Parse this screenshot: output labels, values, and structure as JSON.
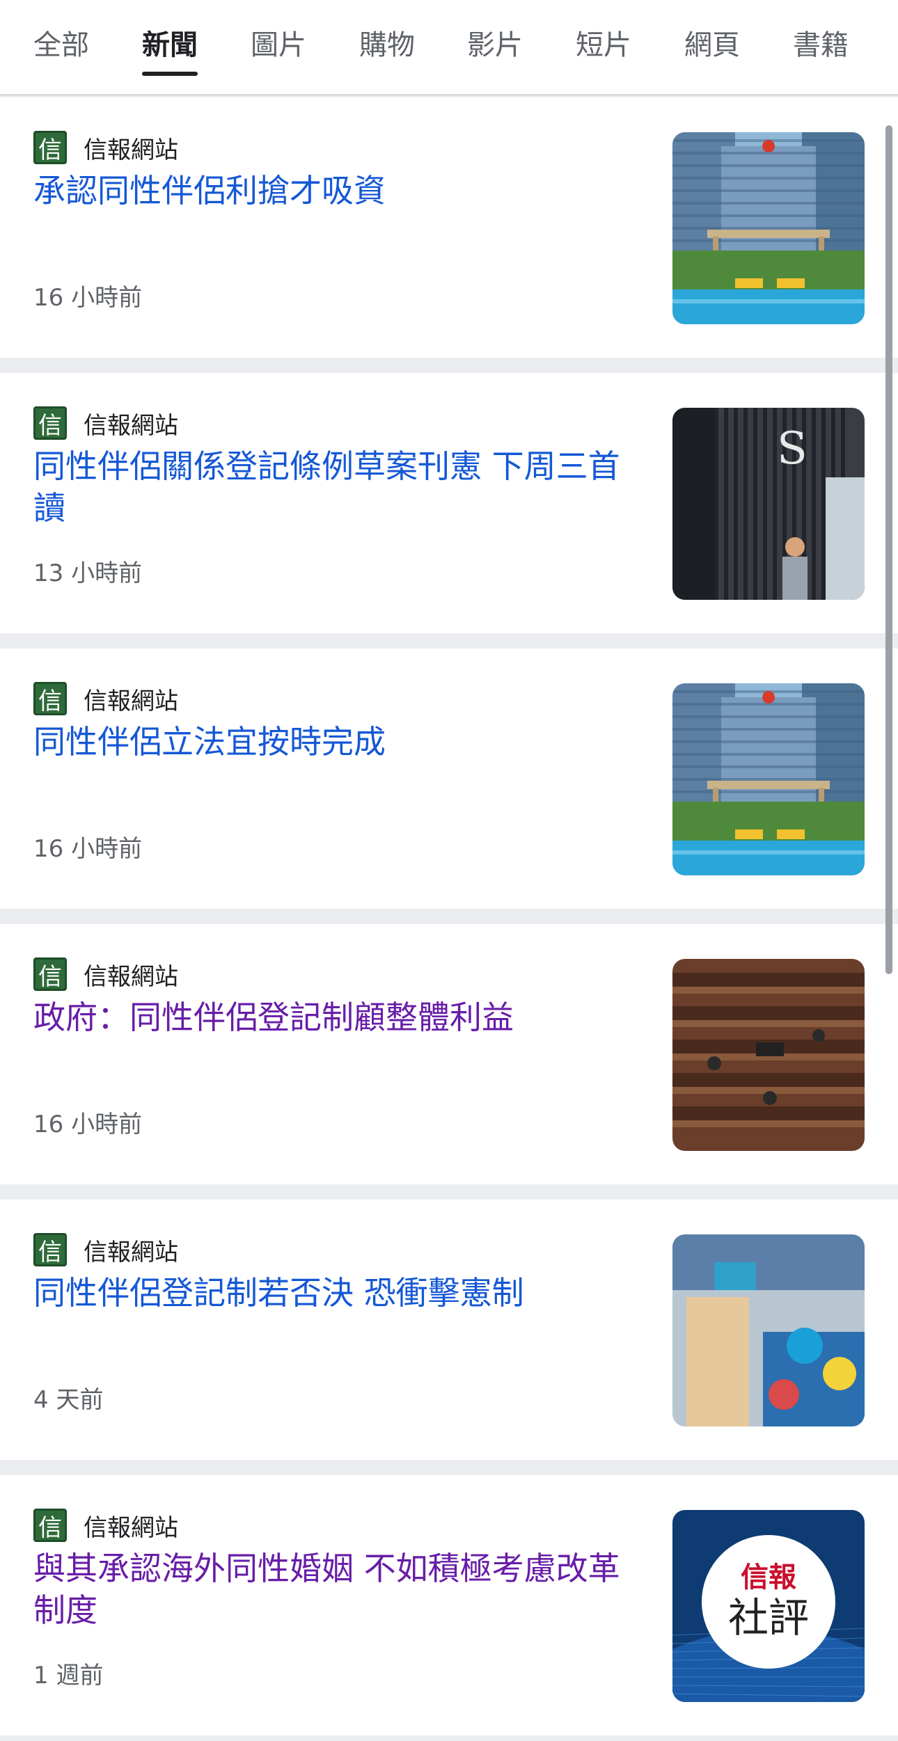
{
  "tabs": [
    {
      "label": "全部"
    },
    {
      "label": "新聞"
    },
    {
      "label": "圖片"
    },
    {
      "label": "購物"
    },
    {
      "label": "影片"
    },
    {
      "label": "短片"
    },
    {
      "label": "網頁"
    },
    {
      "label": "書籍"
    }
  ],
  "active_tab": "新聞",
  "colors": {
    "link": "#1558d6",
    "visited_link": "#681da8",
    "muted_text": "#5f6368",
    "favicon_green": "#2f6b3a"
  },
  "results": [
    {
      "favicon_glyph": "信",
      "source": "信報網站",
      "headline": "承認同性伴侶利搶才吸資",
      "time": "16 小時前",
      "visited": false,
      "thumbnail": "building-pool-image"
    },
    {
      "favicon_glyph": "信",
      "source": "信報網站",
      "headline": "同性伴侶關係登記條例草案刊憲 下周三首讀",
      "time": "13 小時前",
      "visited": false,
      "thumbnail": "building-person-image"
    },
    {
      "favicon_glyph": "信",
      "source": "信報網站",
      "headline": "同性伴侶立法宜按時完成",
      "time": "16 小時前",
      "visited": false,
      "thumbnail": "building-pool-image"
    },
    {
      "favicon_glyph": "信",
      "source": "信報網站",
      "headline": "政府：同性伴侶登記制顧整體利益",
      "time": "16 小時前",
      "visited": true,
      "thumbnail": "legislative-chamber-image"
    },
    {
      "favicon_glyph": "信",
      "source": "信報網站",
      "headline": "同性伴侶登記制若否決 恐衝擊憲制",
      "time": "4 天前",
      "visited": false,
      "thumbnail": "street-crowd-image"
    },
    {
      "favicon_glyph": "信",
      "source": "信報網站",
      "headline": "與其承認海外同性婚姻 不如積極考慮改革制度",
      "time": "1 週前",
      "visited": true,
      "thumbnail": "editorial-logo-image",
      "thumbnail_text": [
        "信報",
        "社評"
      ]
    }
  ]
}
